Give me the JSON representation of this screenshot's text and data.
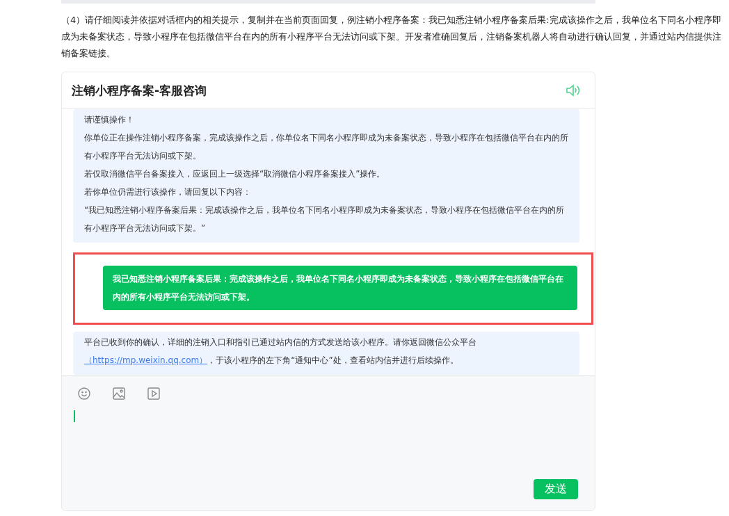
{
  "instruction": "（4）请仔细阅读并依据对话框内的相关提示，复制并在当前页面回复，例注销小程序备案：我已知悉注销小程序备案后果:完成该操作之后，我单位名下同名小程序即成为未备案状态，导致小程序在包括微信平台在内的所有小程序平台无法访问或下架。开发者准确回复后，注销备案机器人将自动进行确认回复，并通过站内信提供注销备案链接。",
  "dialog": {
    "title": "注销小程序备案-客服咨询",
    "messages": [
      {
        "kind": "bot",
        "lines": [
          "请谨慎操作！",
          "你单位正在操作注销小程序备案，完成该操作之后，你单位名下同名小程序即成为未备案状态，导致小程序在包括微信平台在内的所有小程序平台无法访问或下架。",
          "若仅取消微信平台备案接入，应返回上一级选择“取消微信小程序备案接入”操作。",
          "若你单位仍需进行该操作，请回复以下内容：",
          "“我已知悉注销小程序备案后果：完成该操作之后，我单位名下同名小程序即成为未备案状态，导致小程序在包括微信平台在内的所有小程序平台无法访问或下架。”"
        ]
      },
      {
        "kind": "user",
        "highlighted": true,
        "text": "我已知悉注销小程序备案后果：完成该操作之后，我单位名下同名小程序即成为未备案状态，导致小程序在包括微信平台在内的所有小程序平台无法访问或下架。"
      },
      {
        "kind": "link",
        "before": "平台已收到你的确认，详细的注销入口和指引已通过站内信的方式发送给该小程序。请你返回微信公众平台",
        "link": "（https://mp.weixin.qq.com）",
        "after": "，于该小程序的左下角“通知中心”处，查看站内信并进行后续操作。"
      }
    ],
    "send_button": "发送"
  }
}
